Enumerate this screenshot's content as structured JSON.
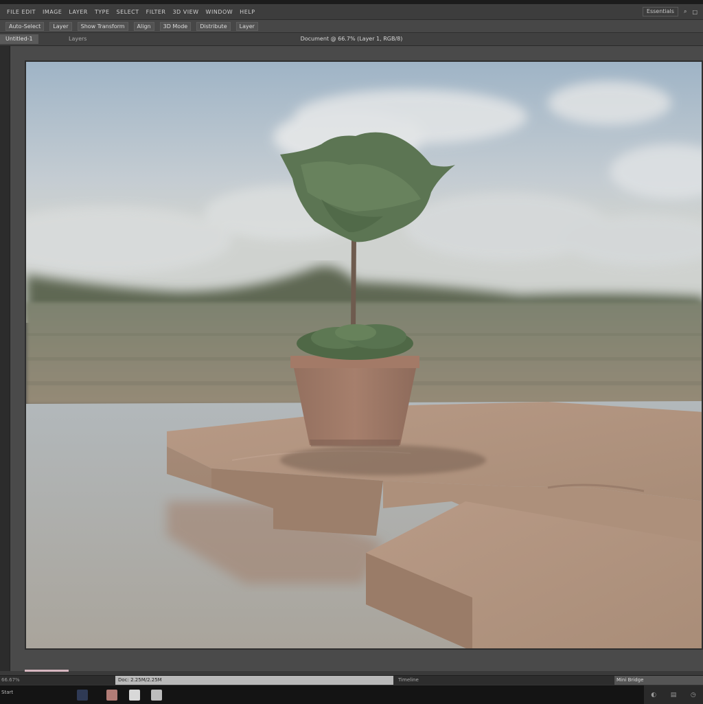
{
  "menubar": {
    "items": [
      "FILE EDIT",
      "IMAGE",
      "LAYER",
      "TYPE",
      "SELECT",
      "FILTER",
      "3D VIEW",
      "WINDOW",
      "HELP"
    ],
    "right": [
      "Essentials",
      "⌕",
      "□"
    ]
  },
  "options": {
    "items": [
      "Auto-Select",
      "Layer",
      "Show Transform",
      "Align",
      "3D Mode",
      "Distribute",
      "Layer"
    ]
  },
  "tabs": {
    "active": "Untitled-1",
    "second": "Layers",
    "document_title": "Document @ 66.7% (Layer 1, RGB/8)"
  },
  "status": {
    "left": "66.67%",
    "middle": "Doc: 2.25M/2.25M",
    "info": "Timeline",
    "right": "Mini Bridge"
  },
  "taskbar": {
    "left": "Start",
    "tray": [
      "◐",
      "▤",
      "◷"
    ]
  },
  "colors": {
    "accent": "#d7b7c0",
    "sky_top": "#a9bccb",
    "sky_bottom": "#cfd3d3",
    "ground": "#8d8a78",
    "water": "#aeb0ad",
    "clay": "#b08f7a",
    "pot": "#a27868",
    "foliage": "#5e7a55"
  },
  "icons": [
    "photoshop-icon",
    "file-icon",
    "note-icon",
    "app-icon"
  ]
}
